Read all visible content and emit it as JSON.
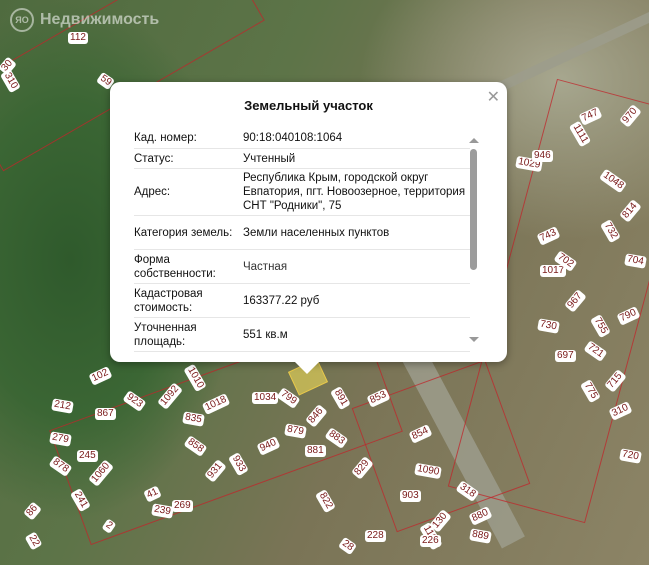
{
  "branding": {
    "logo_text": "Недвижимость",
    "logo_mark": "ЯО"
  },
  "map": {
    "parcel_labels": [
      "112",
      "59",
      "30",
      "310",
      "102",
      "212",
      "867",
      "923",
      "1092",
      "1010",
      "1018",
      "835",
      "1034",
      "799",
      "846",
      "891",
      "853",
      "279",
      "245",
      "878",
      "1060",
      "241",
      "41",
      "239",
      "269",
      "858",
      "931",
      "933",
      "940",
      "879",
      "881",
      "883",
      "829",
      "822",
      "854",
      "1090",
      "903",
      "318",
      "130",
      "1107",
      "880",
      "889",
      "228",
      "28",
      "970",
      "1111",
      "747",
      "1029",
      "946",
      "1048",
      "814",
      "732",
      "743",
      "704",
      "1017",
      "702",
      "967",
      "755",
      "790",
      "730",
      "697",
      "721",
      "715",
      "775",
      "310",
      "720",
      "226",
      "2",
      "86",
      "22"
    ]
  },
  "popup": {
    "title": "Земельный участок",
    "close_icon": "close-icon",
    "rows": [
      {
        "key": "Кад. номер:",
        "value": "90:18:040108:1064"
      },
      {
        "key": "Статус:",
        "value": "Учтенный"
      },
      {
        "key": "Адрес:",
        "value": "Республика Крым, городской округ Евпатория, пгт. Новоозерное, территория СНТ \"Родники\", 75"
      },
      {
        "key": "Категория земель:",
        "value": "Земли населенных пунктов"
      },
      {
        "key": "Форма собственности:",
        "value": "Частная"
      },
      {
        "key": "Кадастровая стоимость:",
        "value": "163377.22 руб"
      },
      {
        "key": "Уточненная площадь:",
        "value": "551 кв.м"
      }
    ]
  }
}
